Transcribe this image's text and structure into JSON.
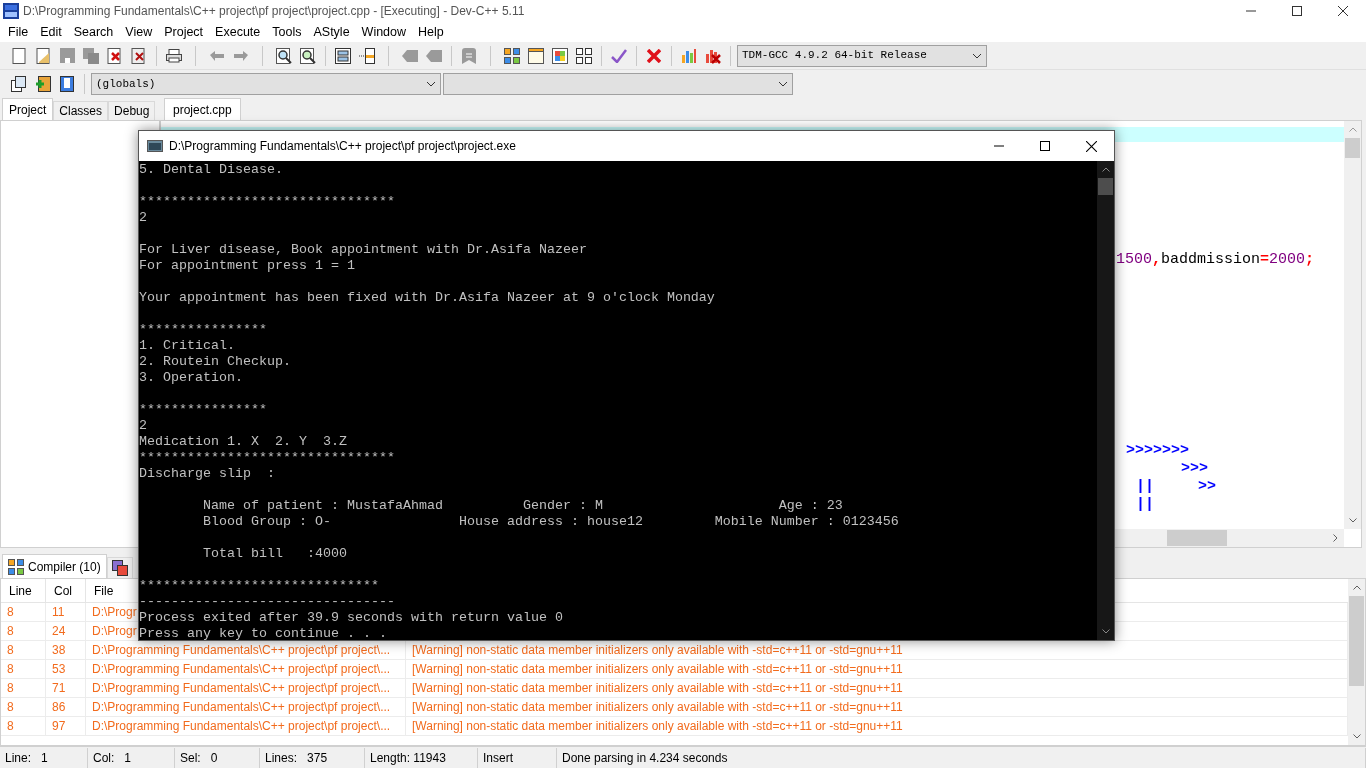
{
  "window": {
    "title": "D:\\Programming Fundamentals\\C++ project\\pf project\\project.cpp - [Executing] - Dev-C++ 5.11"
  },
  "menu": [
    "File",
    "Edit",
    "Search",
    "View",
    "Project",
    "Execute",
    "Tools",
    "AStyle",
    "Window",
    "Help"
  ],
  "toolbar": {
    "compiler": "TDM-GCC 4.9.2 64-bit Release",
    "scope": "(globals)"
  },
  "side_tabs": [
    {
      "label": "Project",
      "selected": true
    },
    {
      "label": "Classes",
      "selected": false
    },
    {
      "label": "Debug",
      "selected": false
    }
  ],
  "editor_tabs": [
    {
      "label": "project.cpp",
      "selected": true
    }
  ],
  "editor": {
    "fragments": [
      {
        "segments": [
          {
            "kind": "number",
            "text": "1500"
          },
          {
            "kind": "symbol",
            "text": ","
          },
          {
            "kind": "identifier",
            "text": "baddmission"
          },
          {
            "kind": "symbol",
            "text": "="
          },
          {
            "kind": "number",
            "text": "2000"
          },
          {
            "kind": "symbol",
            "text": ";"
          }
        ]
      },
      {
        "segments": [
          {
            "kind": "operator",
            "text": ">>>>>>>"
          }
        ]
      },
      {
        "segments": [
          {
            "kind": "operator",
            "text": ">>>"
          }
        ]
      },
      {
        "segments": [
          {
            "kind": "operator",
            "text": "||"
          }
        ]
      },
      {
        "segments": [
          {
            "kind": "operator",
            "text": ">>"
          }
        ]
      },
      {
        "segments": [
          {
            "kind": "operator",
            "text": "||"
          }
        ]
      }
    ]
  },
  "console": {
    "title": "D:\\Programming Fundamentals\\C++ project\\pf project\\project.exe",
    "blocks": [
      [
        "5. Dental Disease."
      ],
      [
        "********************************",
        "2"
      ],
      [
        "For Liver disease, Book appointment with Dr.Asifa Nazeer",
        "For appointment press 1 = 1"
      ],
      [
        "Your appointment has been fixed with Dr.Asifa Nazeer at 9 o'clock Monday"
      ],
      [
        "****************",
        "1. Critical.",
        "2. Routein Checkup.",
        "3. Operation."
      ],
      [
        "****************",
        "2",
        "Medication 1. X  2. Y  3.Z",
        "********************************",
        "Discharge slip  :"
      ],
      [
        "        Name of patient : MustafaAhmad          Gender : M                      Age : 23",
        "        Blood Group : O-                House address : house12         Mobile Number : 0123456"
      ],
      [
        "        Total bill   :4000"
      ],
      [
        "******************************",
        "--------------------------------",
        "Process exited after 39.9 seconds with return value 0",
        "Press any key to continue . . ."
      ]
    ]
  },
  "bottom_tabs": [
    {
      "label": "Compiler (10)",
      "selected": true
    },
    {
      "selected": false
    }
  ],
  "messages": {
    "columns": [
      "Line",
      "Col",
      "File"
    ],
    "rows": [
      {
        "line": "8",
        "col": "11",
        "file": "D:\\Progr"
      },
      {
        "line": "8",
        "col": "24",
        "file": "D:\\Progr"
      },
      {
        "line": "8",
        "col": "38",
        "file": "D:\\Programming Fundamentals\\C++ project\\pf project\\...",
        "message": "[Warning] non-static data member initializers only available with -std=c++11 or -std=gnu++11"
      },
      {
        "line": "8",
        "col": "53",
        "file": "D:\\Programming Fundamentals\\C++ project\\pf project\\...",
        "message": "[Warning] non-static data member initializers only available with -std=c++11 or -std=gnu++11"
      },
      {
        "line": "8",
        "col": "71",
        "file": "D:\\Programming Fundamentals\\C++ project\\pf project\\...",
        "message": "[Warning] non-static data member initializers only available with -std=c++11 or -std=gnu++11"
      },
      {
        "line": "8",
        "col": "86",
        "file": "D:\\Programming Fundamentals\\C++ project\\pf project\\...",
        "message": "[Warning] non-static data member initializers only available with -std=c++11 or -std=gnu++11"
      },
      {
        "line": "8",
        "col": "97",
        "file": "D:\\Programming Fundamentals\\C++ project\\pf project\\...",
        "message": "[Warning] non-static data member initializers only available with -std=c++11 or -std=gnu++11"
      }
    ]
  },
  "status_bar": [
    {
      "label": "Line:",
      "value": "1"
    },
    {
      "label": "Col:",
      "value": "1"
    },
    {
      "label": "Sel:",
      "value": "0"
    },
    {
      "label": "Lines:",
      "value": "375"
    },
    {
      "label": "Length: 11943"
    },
    {
      "label": "Insert"
    },
    {
      "label": "Done parsing in 4.234 seconds"
    }
  ]
}
